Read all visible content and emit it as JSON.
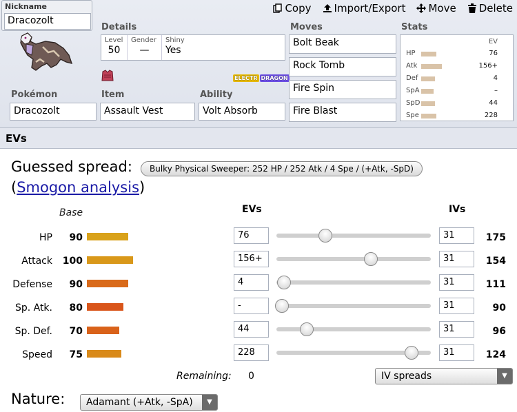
{
  "toolbar": {
    "copy": "Copy",
    "import_export": "Import/Export",
    "move": "Move",
    "delete": "Delete"
  },
  "set": {
    "nickname_label": "Nickname",
    "nickname": "Dracozolt",
    "details_label": "Details",
    "level_label": "Level",
    "level": "50",
    "gender_label": "Gender",
    "gender": "—",
    "shiny_label": "Shiny",
    "shiny": "Yes",
    "types": [
      {
        "name": "ELECTR",
        "color": "#e5b800"
      },
      {
        "name": "DRAGON",
        "color": "#6c4fe3"
      }
    ],
    "pokemon_label": "Pokémon",
    "pokemon": "Dracozolt",
    "item_label": "Item",
    "item": "Assault Vest",
    "ability_label": "Ability",
    "ability": "Volt Absorb",
    "moves_label": "Moves",
    "moves": [
      "Bolt Beak",
      "Rock Tomb",
      "Fire Spin",
      "Fire Blast"
    ],
    "stats_label": "Stats",
    "stats_ev_head": "EV",
    "stats": [
      {
        "name": "HP",
        "ev": "76",
        "bar": 0.22
      },
      {
        "name": "Atk",
        "ev": "156+",
        "bar": 0.3
      },
      {
        "name": "Def",
        "ev": "4",
        "bar": 0.2
      },
      {
        "name": "SpA",
        "ev": "–",
        "bar": 0.18
      },
      {
        "name": "SpD",
        "ev": "44",
        "bar": 0.2
      },
      {
        "name": "Spe",
        "ev": "228",
        "bar": 0.22
      }
    ]
  },
  "evs": {
    "header": "EVs",
    "guessed_label": "Guessed spread:",
    "guessed_button": "Bulky Physical Sweeper: 252 HP / 252 Atk / 4 Spe / (+Atk, -SpD)",
    "smogon_open": "(",
    "smogon_link": "Smogon analysis",
    "smogon_close": ")",
    "base_head": "Base",
    "evs_head": "EVs",
    "ivs_head": "IVs",
    "rows": [
      {
        "stat": "HP",
        "base": "90",
        "base_color": "#d9a21a",
        "ev": "76",
        "ev_num": 76,
        "iv": "31",
        "total": "175"
      },
      {
        "stat": "Attack",
        "base": "100",
        "base_color": "#d9981a",
        "ev": "156+",
        "ev_num": 156,
        "iv": "31",
        "total": "154"
      },
      {
        "stat": "Defense",
        "base": "90",
        "base_color": "#d96a1a",
        "ev": "4",
        "ev_num": 4,
        "iv": "31",
        "total": "111"
      },
      {
        "stat": "Sp. Atk.",
        "base": "80",
        "base_color": "#d9551a",
        "ev": "-",
        "ev_num": 0,
        "iv": "31",
        "total": "90"
      },
      {
        "stat": "Sp. Def.",
        "base": "70",
        "base_color": "#d9621a",
        "ev": "44",
        "ev_num": 44,
        "iv": "31",
        "total": "96"
      },
      {
        "stat": "Speed",
        "base": "75",
        "base_color": "#d98a1a",
        "ev": "228",
        "ev_num": 228,
        "iv": "31",
        "total": "124"
      }
    ],
    "ev_max": 252,
    "base_max": 255,
    "remaining_label": "Remaining:",
    "remaining": "0",
    "iv_spreads": "IV spreads",
    "nature_label": "Nature:",
    "nature": "Adamant (+Atk, -SpA)"
  }
}
